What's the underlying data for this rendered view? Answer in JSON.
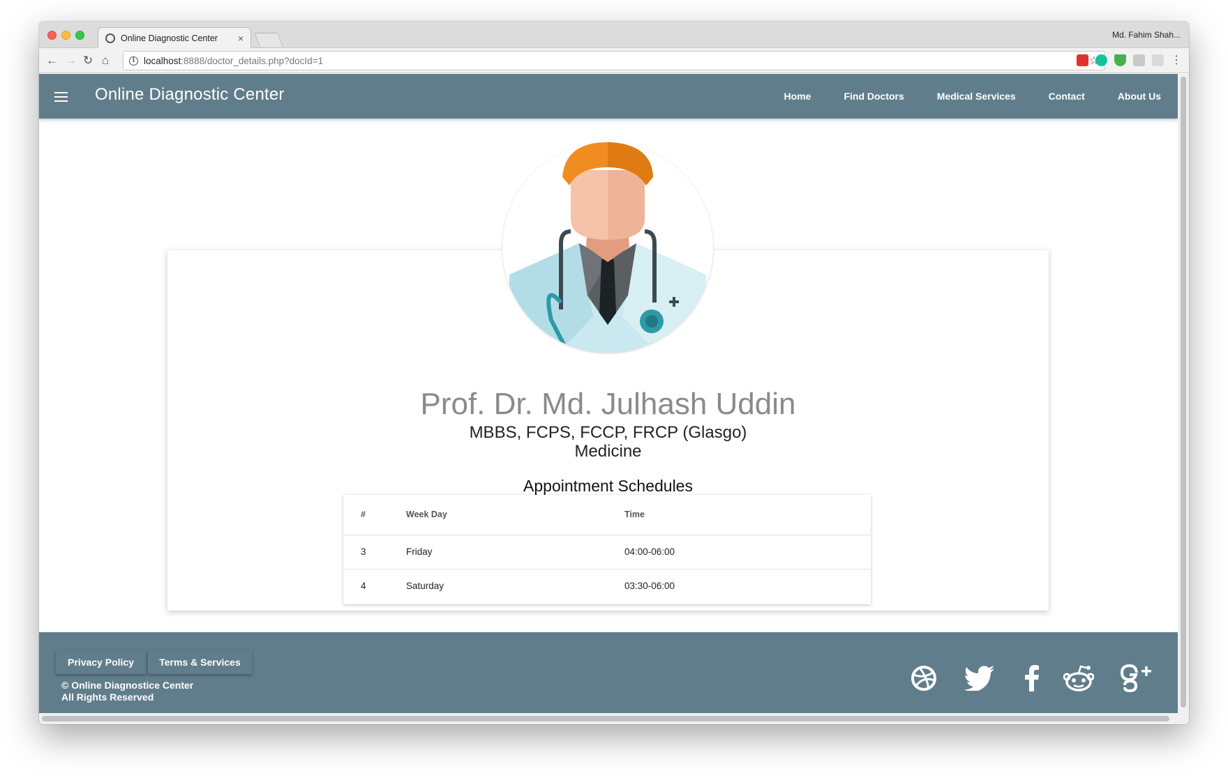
{
  "browser": {
    "tab_title": "Online Diagnostic Center",
    "tab_close": "×",
    "profile_name": "Md. Fahim Shah...",
    "url_host": "localhost",
    "url_rest": ":8888/doctor_details.php?docId=1"
  },
  "navbar": {
    "brand": "Online Diagnostic Center",
    "links": [
      "Home",
      "Find Doctors",
      "Medical Services",
      "Contact",
      "About Us"
    ],
    "color": "#607d8b"
  },
  "doctor": {
    "name": "Prof. Dr. Md. Julhash Uddin",
    "degrees": "MBBS, FCPS, FCCP, FRCP (Glasgo)",
    "department": "Medicine"
  },
  "schedule": {
    "title": "Appointment Schedules",
    "headers": [
      "#",
      "Week Day",
      "Time"
    ],
    "rows": [
      {
        "num": "3",
        "day": "Friday",
        "time": "04:00-06:00"
      },
      {
        "num": "4",
        "day": "Saturday",
        "time": "03:30-06:00"
      }
    ]
  },
  "footer": {
    "privacy": "Privacy Policy",
    "terms": "Terms & Services",
    "copyright_line1": "© Online Diagnostice Center",
    "copyright_line2": "All Rights Reserved",
    "social_icons": [
      "dribbble-icon",
      "twitter-icon",
      "facebook-icon",
      "reddit-icon",
      "google-plus-icon"
    ]
  }
}
